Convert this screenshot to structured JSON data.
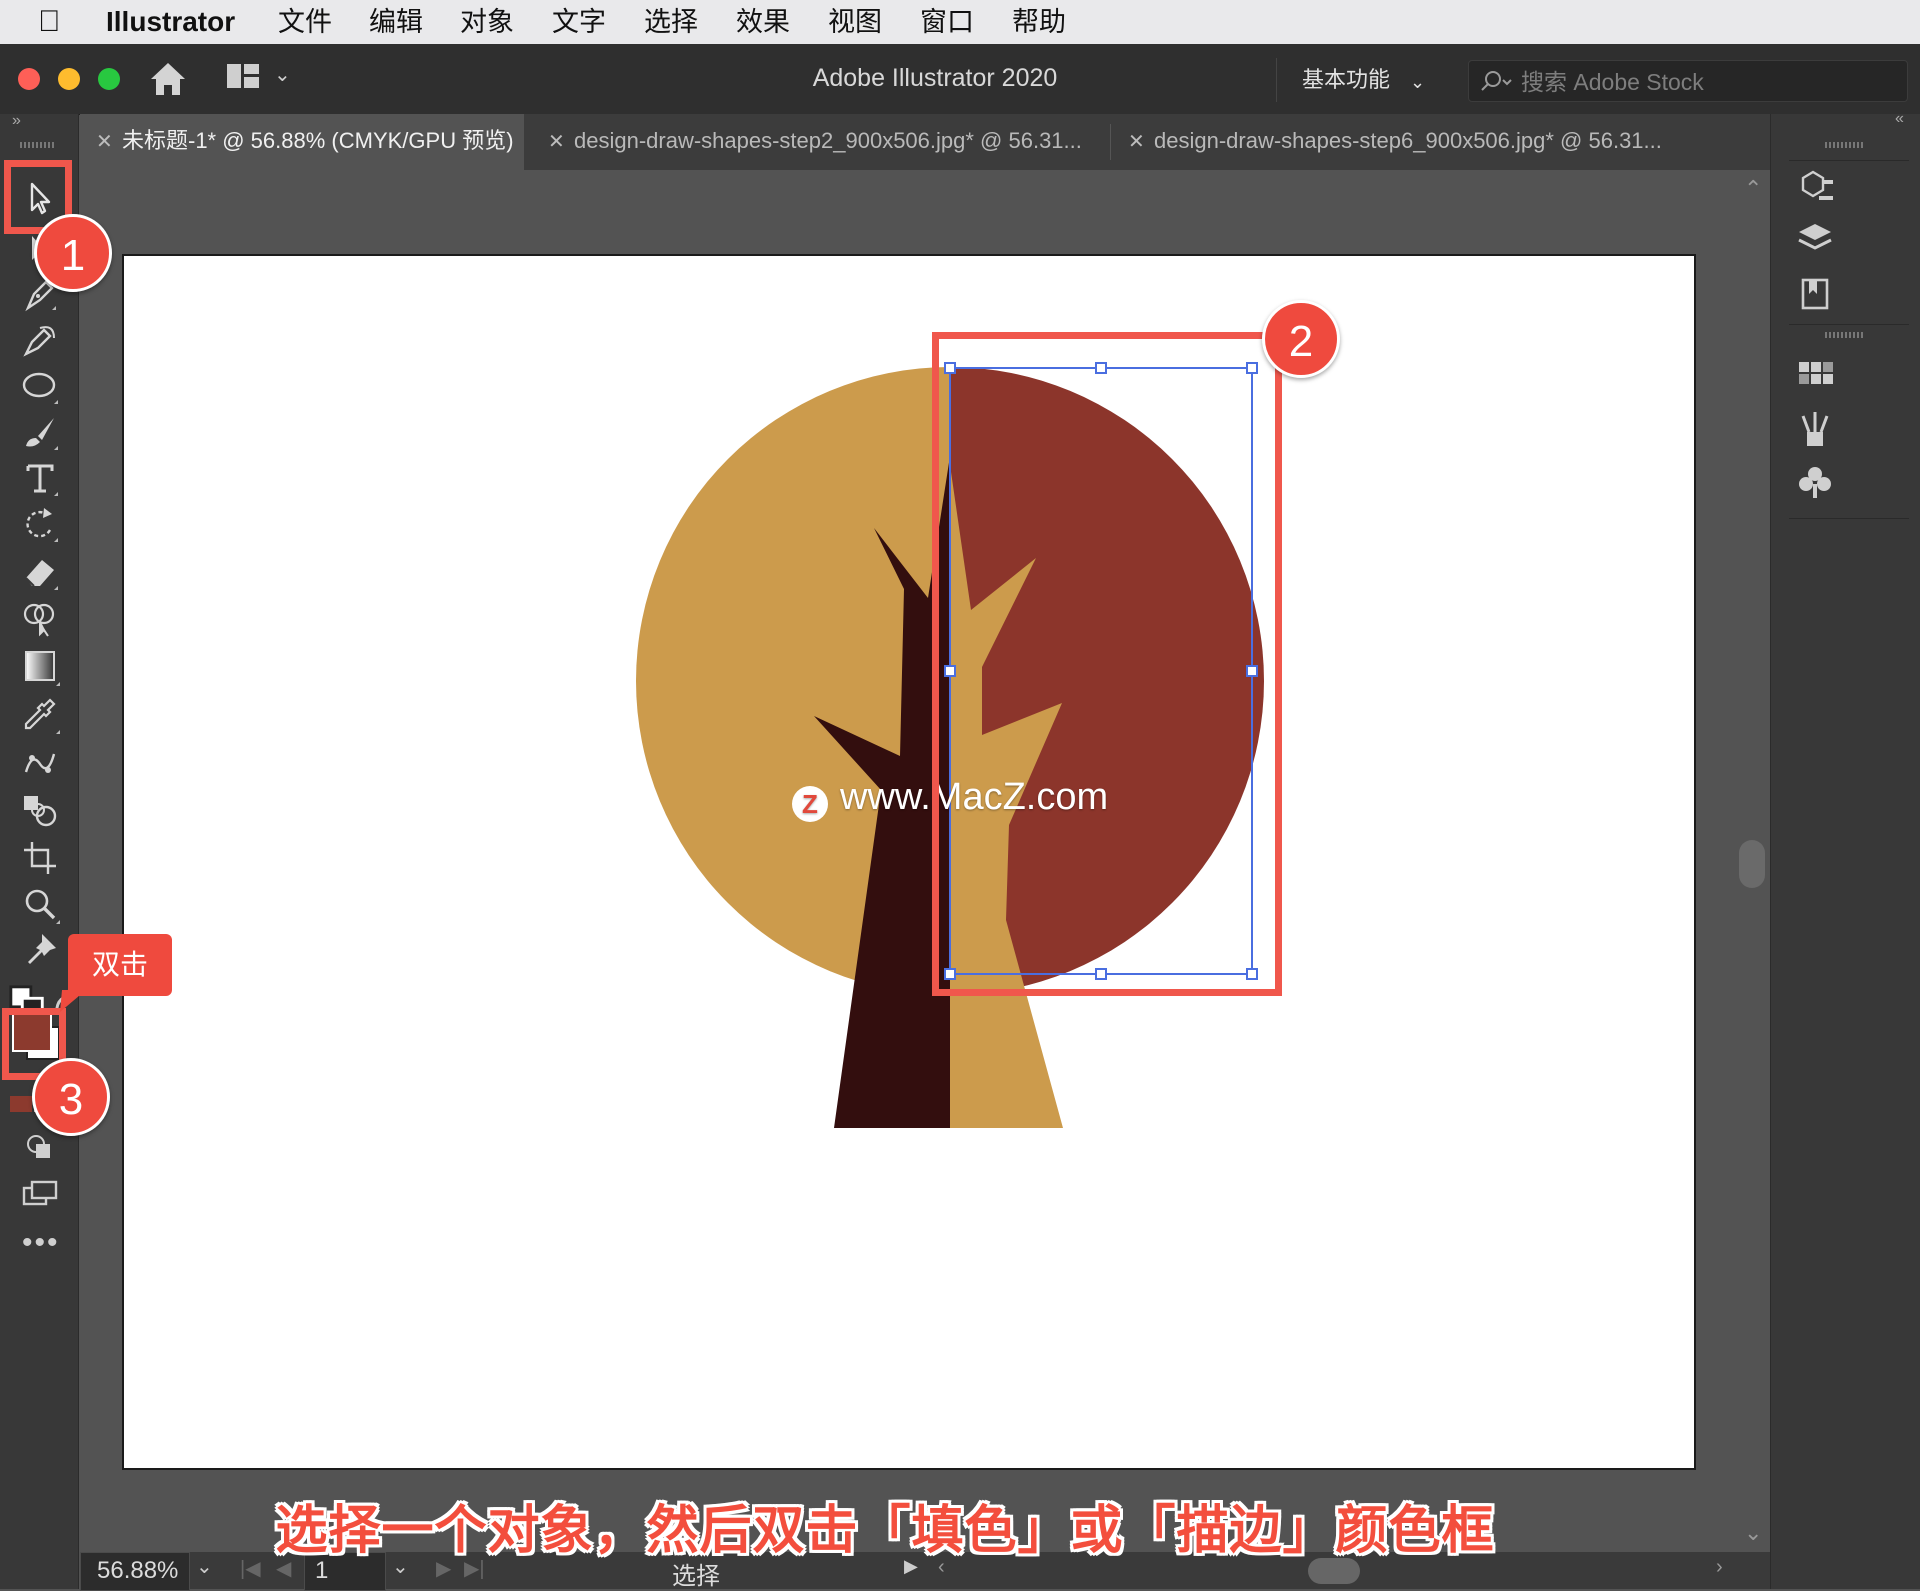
{
  "menubar": {
    "app_name": "Illustrator",
    "items": [
      "文件",
      "编辑",
      "对象",
      "文字",
      "选择",
      "效果",
      "视图",
      "窗口",
      "帮助"
    ]
  },
  "titlebar": {
    "title": "Adobe Illustrator 2020",
    "workspace": "基本功能",
    "search_placeholder": "搜索 Adobe Stock"
  },
  "tabs": [
    {
      "label": "未标题-1* @ 56.88% (CMYK/GPU 预览)",
      "active": true
    },
    {
      "label": "design-draw-shapes-step2_900x506.jpg* @ 56.31...",
      "active": false
    },
    {
      "label": "design-draw-shapes-step6_900x506.jpg* @ 56.31...",
      "active": false
    }
  ],
  "tools": [
    "selection-tool",
    "direct-selection-tool",
    "pen-tool",
    "curvature-tool",
    "ellipse-tool",
    "paintbrush-tool",
    "type-tool",
    "rotate-tool",
    "eraser-tool",
    "shape-builder-tool",
    "gradient-tool",
    "eyedropper-tool",
    "puppet-warp-tool",
    "blend-tool",
    "artboard-tool",
    "zoom-tool",
    "pin-tool"
  ],
  "colors": {
    "fill": "#8c3a2e",
    "circle_light": "#cc9b4c",
    "circle_dark": "#8c352b",
    "trunk_dark": "#330e0e",
    "trunk_light": "#cc9b4c",
    "annotation": "#f0574c",
    "selection": "#4a6ee0"
  },
  "annotations": {
    "badge1": "1",
    "badge2": "2",
    "badge3": "3",
    "double_click": "双击",
    "caption": "选择一个对象，然后双击「填色」或「描边」颜色框"
  },
  "watermark": "www.MacZ.com",
  "statusbar": {
    "zoom": "56.88%",
    "artboard_number": "1",
    "tool_name": "选择"
  }
}
